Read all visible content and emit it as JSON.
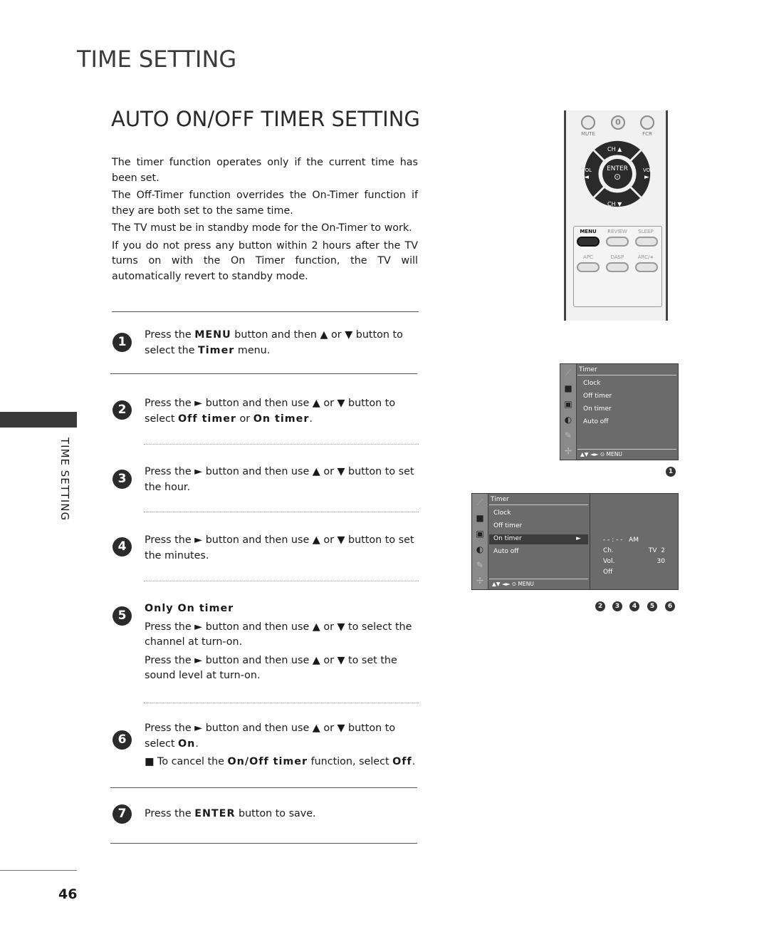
{
  "page": {
    "section_title": "TIME SETTING",
    "title": "AUTO ON/OFF TIMER SETTING",
    "side_label": "TIME SETTING",
    "page_number": "46"
  },
  "intro": [
    "The timer function operates only if the current time has been set.",
    "The Off-Timer function overrides the On-Timer function if they are both set to the same time.",
    "The TV must be in standby mode for the On-Timer to work.",
    "If you do not press any button within 2 hours after the TV turns on with the On Timer function, the TV will automatically revert to standby mode."
  ],
  "steps": [
    {
      "num": "1",
      "parts": [
        "Press the ",
        "MENU",
        " button and then ▲ or ▼ button to select the ",
        "Timer",
        " menu."
      ]
    },
    {
      "num": "2",
      "parts": [
        "Press the ► button and then use ▲ or ▼ button to select ",
        "Off timer",
        " or ",
        "On timer",
        "."
      ]
    },
    {
      "num": "3",
      "text": "Press the ► button and then use ▲ or ▼ button to set the hour."
    },
    {
      "num": "4",
      "text": "Press the ► button and then use ▲ or ▼ button to set the minutes."
    },
    {
      "num": "5",
      "heading": "Only On timer",
      "lines": [
        "Press the ► button and then use ▲ or ▼ to select the channel at turn-on.",
        "Press the ► button and then use ▲ or ▼ to set the sound level at turn-on."
      ]
    },
    {
      "num": "6",
      "parts": [
        "Press the ► button and then use ▲ or ▼ button to select ",
        "On",
        "."
      ],
      "note_parts": [
        "■ To cancel the ",
        "On/Off timer",
        " function, select ",
        "Off",
        "."
      ]
    },
    {
      "num": "7",
      "parts": [
        "Press the ",
        "ENTER",
        " button to save."
      ]
    }
  ],
  "remote": {
    "mute": "MUTE",
    "zero": "0",
    "fcr": "FCR",
    "ch_up": "CH ▲",
    "ch_down": "CH ▼",
    "vol_left": "VOL",
    "vol_right": "VOL",
    "vol_left_arrow": "◄",
    "vol_right_arrow": "►",
    "enter": "ENTER",
    "enter_symbol": "⊙",
    "menu": "MENU",
    "review": "REVIEW",
    "sleep": "SLEEP",
    "apc": "APC",
    "dasp": "DASP",
    "arc": "ARC/∗"
  },
  "osd1": {
    "title": "Timer",
    "items": [
      "Clock",
      "Off timer",
      "On timer",
      "Auto off"
    ],
    "footer": "▲▼  ◄►  ⊙  MENU",
    "badge": "1"
  },
  "osd2": {
    "title": "Timer",
    "items": [
      "Clock",
      "Off timer",
      "On timer",
      "Auto off"
    ],
    "selected_arrow": "►",
    "footer": "▲▼  ◄►  ⊙  MENU",
    "time": "- - : - -   AM",
    "ch_label": "Ch.",
    "ch_value": "TV  2",
    "vol_label": "Vol.",
    "vol_value": "30",
    "state": "Off",
    "badges": [
      "2",
      "3",
      "4",
      "5",
      "6"
    ]
  },
  "icons": [
    "antenna-icon",
    "picture-icon",
    "speaker-icon",
    "clock-icon",
    "remote-icon",
    "option-icon"
  ]
}
